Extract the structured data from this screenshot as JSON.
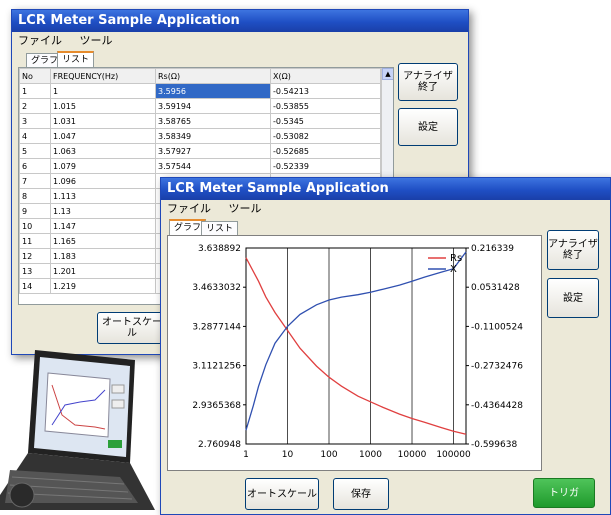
{
  "app_title": "LCR Meter Sample Application",
  "menu": {
    "file": "ファイル",
    "tools": "ツール"
  },
  "tabs": {
    "graph": "グラフ",
    "list": "リスト"
  },
  "buttons": {
    "analyzer_end": "アナライザ\n終了",
    "settings": "設定",
    "autoscale": "オートスケール",
    "save": "保存",
    "trigger": "トリガ"
  },
  "list": {
    "headers": [
      "No",
      "FREQUENCY(Hz)",
      "Rs(Ω)",
      "X(Ω)"
    ],
    "rows": [
      [
        "1",
        "1",
        "3.5956",
        "-0.54213"
      ],
      [
        "2",
        "1.015",
        "3.59194",
        "-0.53855"
      ],
      [
        "3",
        "1.031",
        "3.58765",
        "-0.5345"
      ],
      [
        "4",
        "1.047",
        "3.58349",
        "-0.53082"
      ],
      [
        "5",
        "1.063",
        "3.57927",
        "-0.52685"
      ],
      [
        "6",
        "1.079",
        "3.57544",
        "-0.52339"
      ],
      [
        "7",
        "1.096",
        "",
        ""
      ],
      [
        "8",
        "1.113",
        "",
        ""
      ],
      [
        "9",
        "1.13",
        "",
        ""
      ],
      [
        "10",
        "1.147",
        "",
        ""
      ],
      [
        "11",
        "1.165",
        "",
        ""
      ],
      [
        "12",
        "1.183",
        "",
        ""
      ],
      [
        "13",
        "1.201",
        "",
        ""
      ],
      [
        "14",
        "1.219",
        "",
        ""
      ]
    ]
  },
  "chart_data": {
    "type": "line",
    "title": "",
    "xlabel": "",
    "ylabel": "",
    "x_scale": "log",
    "x_ticks": [
      "1",
      "10",
      "100",
      "1000",
      "10000",
      "100000"
    ],
    "y_left_ticks": [
      "3.638892",
      "3.4633032",
      "3.2877144",
      "3.1121256",
      "2.9365368",
      "2.760948"
    ],
    "y_right_ticks": [
      "0.216339",
      "0.0531428",
      "-0.1100524",
      "-0.2732476",
      "-0.4364428",
      "-0.599638"
    ],
    "grid": true,
    "legend_position": "top-right",
    "series": [
      {
        "name": "Rs",
        "color": "#e04040",
        "axis": "left",
        "x": [
          1,
          2,
          3,
          5,
          10,
          20,
          50,
          100,
          200,
          500,
          1000,
          2000,
          5000,
          10000,
          20000,
          50000,
          100000,
          200000
        ],
        "y": [
          3.5956,
          3.49,
          3.42,
          3.35,
          3.27,
          3.19,
          3.11,
          3.06,
          3.02,
          2.975,
          2.95,
          2.925,
          2.895,
          2.875,
          2.858,
          2.835,
          2.818,
          2.805
        ]
      },
      {
        "name": "X",
        "color": "#3050b0",
        "axis": "right",
        "x": [
          1,
          1.5,
          2,
          3,
          5,
          10,
          20,
          50,
          100,
          200,
          500,
          1000,
          2000,
          5000,
          10000,
          20000,
          50000,
          100000,
          200000
        ],
        "y": [
          -0.54213,
          -0.44,
          -0.36,
          -0.27,
          -0.18,
          -0.11,
          -0.06,
          -0.02,
          0.0,
          0.012,
          0.022,
          0.032,
          0.045,
          0.062,
          0.078,
          0.095,
          0.115,
          0.13,
          0.2
        ]
      }
    ],
    "y_left_range": [
      2.760948,
      3.638892
    ],
    "y_right_range": [
      -0.599638,
      0.216339
    ]
  }
}
